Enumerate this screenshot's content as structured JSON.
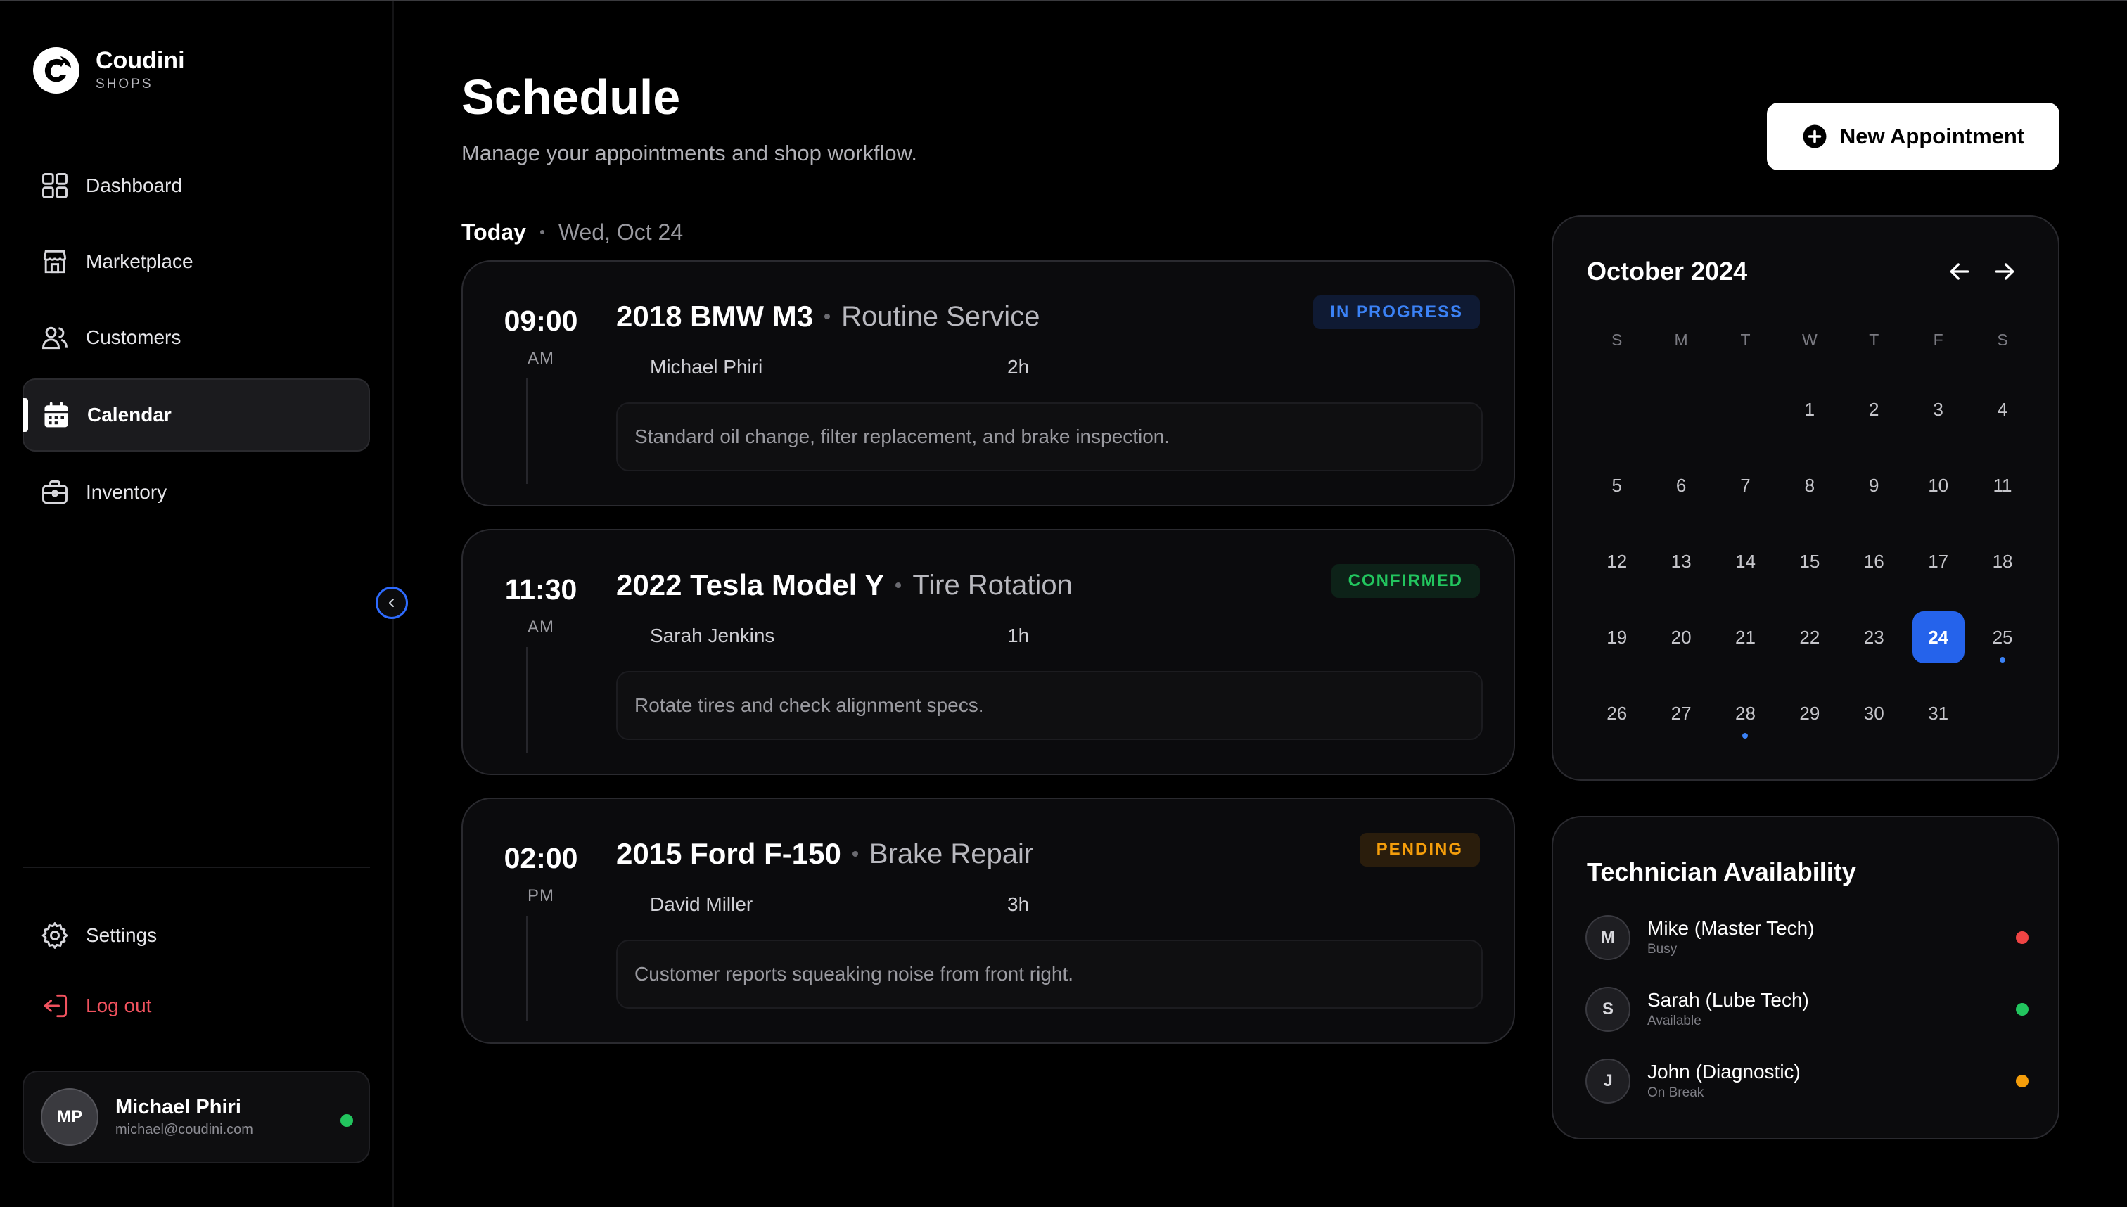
{
  "brand": {
    "name": "Coudini",
    "sub": "SHOPS"
  },
  "nav": {
    "items": [
      {
        "label": "Dashboard"
      },
      {
        "label": "Marketplace"
      },
      {
        "label": "Customers"
      },
      {
        "label": "Calendar"
      },
      {
        "label": "Inventory"
      }
    ]
  },
  "bottom_nav": {
    "settings": "Settings",
    "logout": "Log out"
  },
  "user": {
    "initials": "MP",
    "name": "Michael Phiri",
    "email": "michael@coudini.com"
  },
  "header": {
    "title": "Schedule",
    "subtitle": "Manage your appointments and shop workflow.",
    "new_button": "New Appointment"
  },
  "today": {
    "label": "Today",
    "date": "Wed, Oct 24"
  },
  "appointments": [
    {
      "time": "09:00",
      "ampm": "AM",
      "vehicle": "2018 BMW M3",
      "service": "Routine Service",
      "status": "IN PROGRESS",
      "technician": "Michael Phiri",
      "duration": "2h",
      "note": "Standard oil change, filter replacement, and brake inspection."
    },
    {
      "time": "11:30",
      "ampm": "AM",
      "vehicle": "2022 Tesla Model Y",
      "service": "Tire Rotation",
      "status": "CONFIRMED",
      "technician": "Sarah Jenkins",
      "duration": "1h",
      "note": "Rotate tires and check alignment specs."
    },
    {
      "time": "02:00",
      "ampm": "PM",
      "vehicle": "2015 Ford F-150",
      "service": "Brake Repair",
      "status": "PENDING",
      "technician": "David Miller",
      "duration": "3h",
      "note": "Customer reports squeaking noise from front right."
    }
  ],
  "calendar": {
    "title": "October 2024",
    "weekdays": [
      "S",
      "M",
      "T",
      "W",
      "T",
      "F",
      "S"
    ],
    "weeks": [
      [
        "",
        "",
        "",
        "1",
        "2",
        "3",
        "4"
      ],
      [
        "5",
        "6",
        "7",
        "8",
        "9",
        "10",
        "11"
      ],
      [
        "12",
        "13",
        "14",
        "15",
        "16",
        "17",
        "18"
      ],
      [
        "19",
        "20",
        "21",
        "22",
        "23",
        "24",
        "25"
      ],
      [
        "26",
        "27",
        "28",
        "29",
        "30",
        "31",
        ""
      ]
    ],
    "selected": "24",
    "event_days": [
      "25",
      "28"
    ],
    "accent": "#2563eb"
  },
  "technicians": {
    "title": "Technician Availability",
    "list": [
      {
        "initial": "M",
        "name": "Mike (Master Tech)",
        "status": "Busy",
        "color": "#ef4444"
      },
      {
        "initial": "S",
        "name": "Sarah (Lube Tech)",
        "status": "Available",
        "color": "#22c55e"
      },
      {
        "initial": "J",
        "name": "John (Diagnostic)",
        "status": "On Break",
        "color": "#f59e0b"
      }
    ]
  }
}
